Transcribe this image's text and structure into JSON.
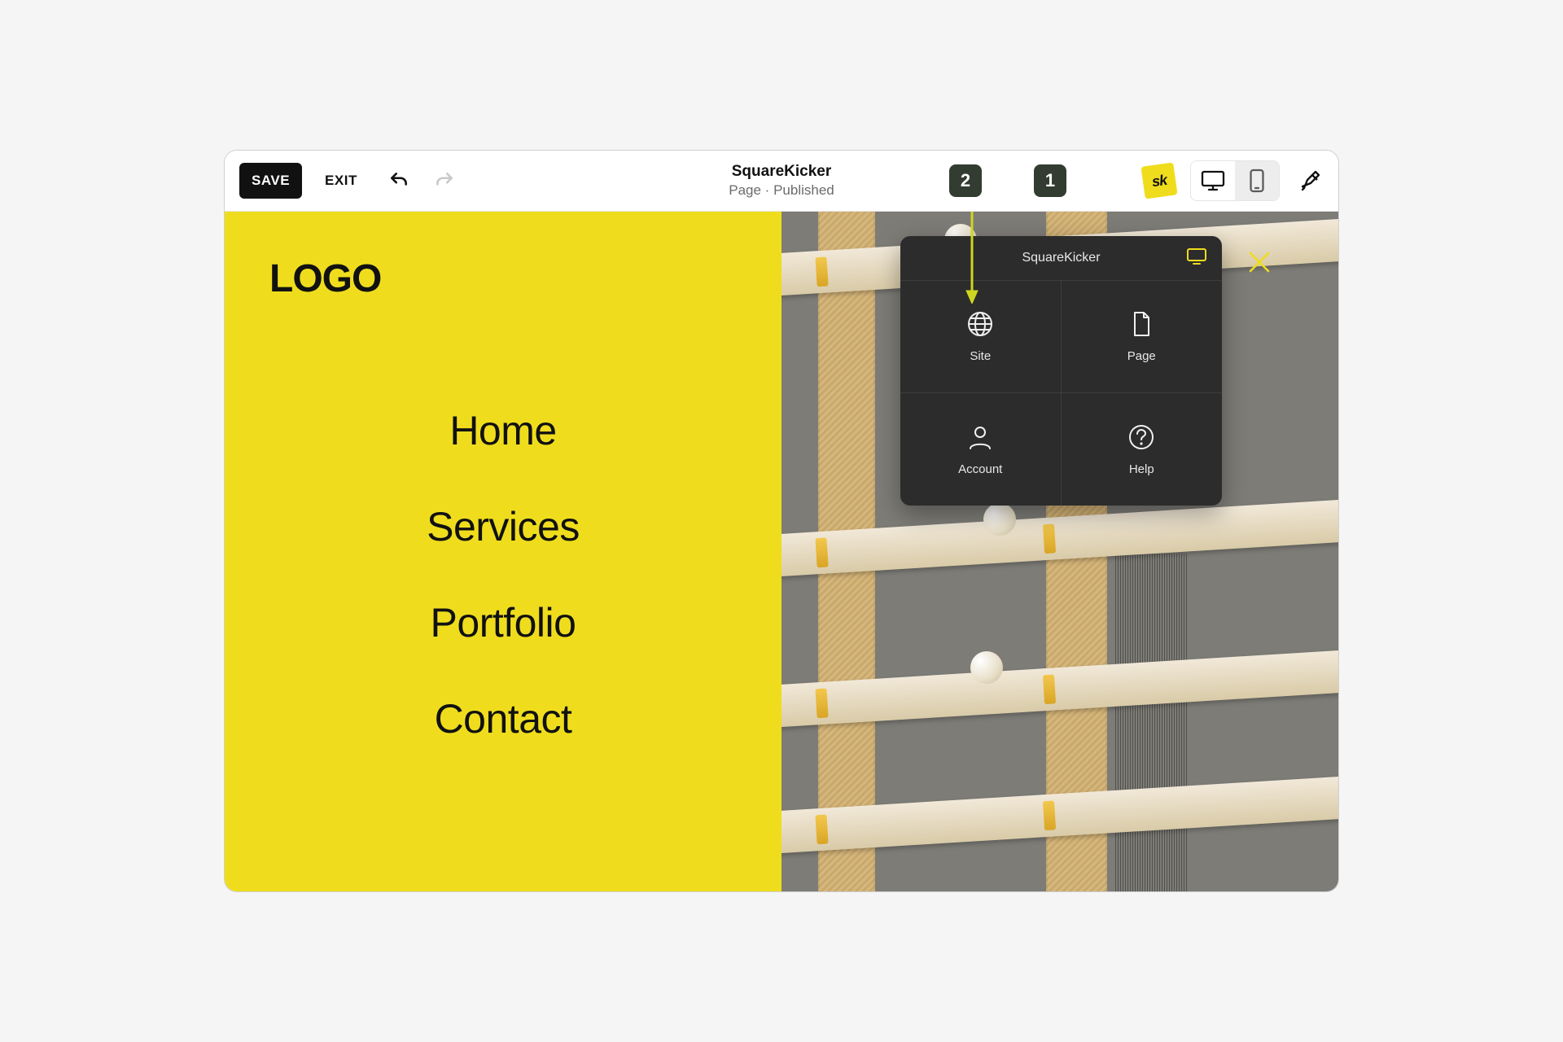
{
  "toolbar": {
    "save_label": "SAVE",
    "exit_label": "EXIT",
    "title": "SquareKicker",
    "subtitle": "Page · Published",
    "step_badges": [
      "2",
      "1"
    ],
    "sk_logo_text": "sk"
  },
  "site": {
    "logo_text": "LOGO",
    "nav_items": [
      "Home",
      "Services",
      "Portfolio",
      "Contact"
    ]
  },
  "sk_panel": {
    "title": "SquareKicker",
    "tiles": [
      {
        "label": "Site",
        "icon": "globe-icon"
      },
      {
        "label": "Page",
        "icon": "file-icon"
      },
      {
        "label": "Account",
        "icon": "user-icon"
      },
      {
        "label": "Help",
        "icon": "question-icon"
      }
    ]
  },
  "colors": {
    "accent_yellow": "#efdd1d",
    "panel_bg": "#2c2c2c",
    "arrow": "#ced521"
  }
}
